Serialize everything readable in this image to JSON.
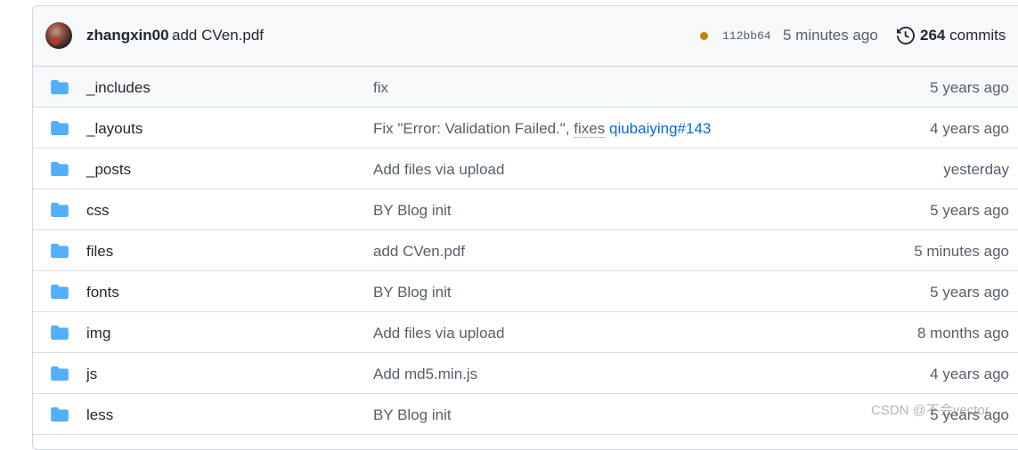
{
  "commit": {
    "author": "zhangxin00",
    "message": "add CVen.pdf",
    "status_color": "#bf8700",
    "sha": "112bb64",
    "time": "5 minutes ago",
    "commit_count": "264",
    "commit_count_label": "commits"
  },
  "files": [
    {
      "name": "_includes",
      "message": "fix",
      "age": "5 years ago",
      "icon": "folder-icon"
    },
    {
      "name": "_layouts",
      "message_prefix": "Fix \"Error: Validation Failed.\", ",
      "fixes_word": "fixes",
      "issue_link": "qiubaiying#143",
      "age": "4 years ago",
      "icon": "folder-icon"
    },
    {
      "name": "_posts",
      "message": "Add files via upload",
      "age": "yesterday",
      "icon": "folder-icon"
    },
    {
      "name": "css",
      "message": "BY Blog init",
      "age": "5 years ago",
      "icon": "folder-icon"
    },
    {
      "name": "files",
      "message": "add CVen.pdf",
      "age": "5 minutes ago",
      "icon": "folder-icon"
    },
    {
      "name": "fonts",
      "message": "BY Blog init",
      "age": "5 years ago",
      "icon": "folder-icon"
    },
    {
      "name": "img",
      "message": "Add files via upload",
      "age": "8 months ago",
      "icon": "folder-icon"
    },
    {
      "name": "js",
      "message": "Add md5.min.js",
      "age": "4 years ago",
      "icon": "folder-icon"
    },
    {
      "name": "less",
      "message": "BY Blog init",
      "age": "5 years ago",
      "icon": "folder-icon"
    }
  ],
  "colors": {
    "folder": "#54aeff",
    "link": "#0969da"
  },
  "watermark": "CSDN @不会vector"
}
